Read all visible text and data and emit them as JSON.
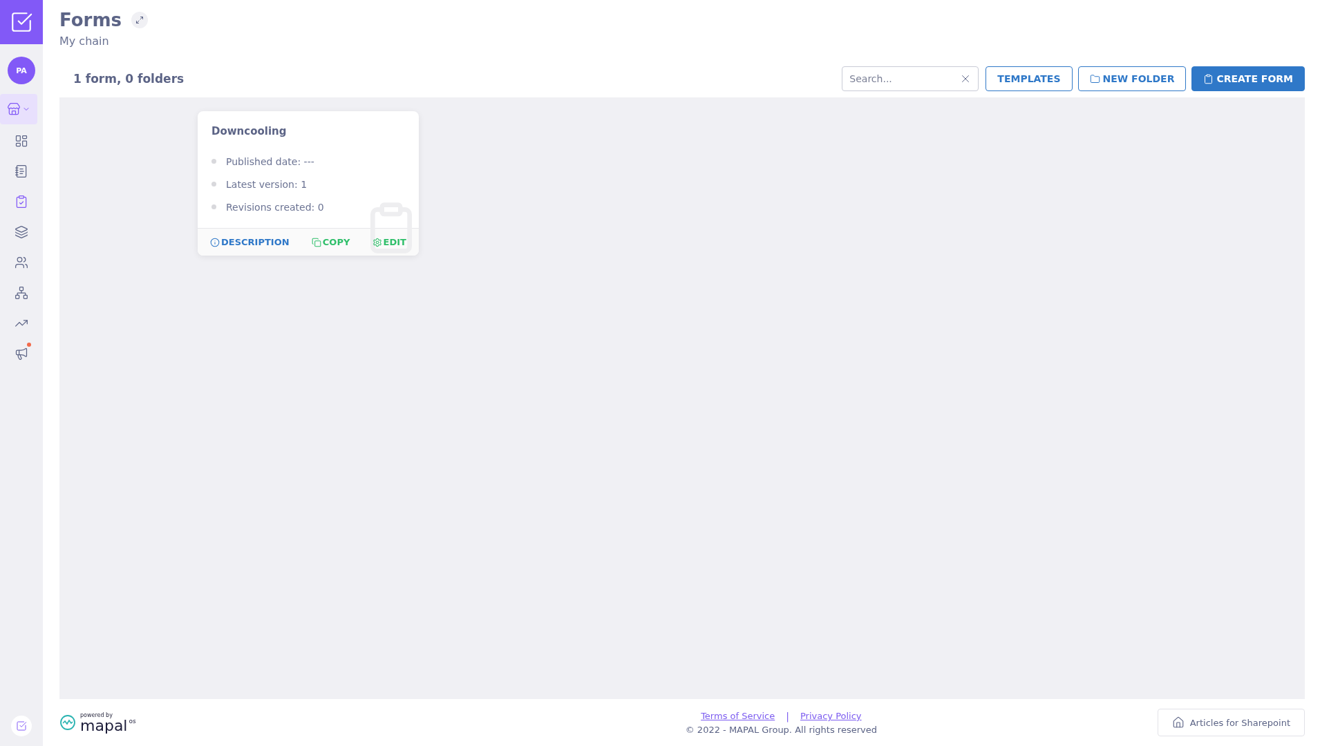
{
  "sidebar": {
    "avatar": "PA",
    "items": [
      {
        "kind": "dropdown",
        "selected": true,
        "badge": false
      },
      {
        "kind": "link",
        "selected": false,
        "badge": false
      },
      {
        "kind": "link",
        "selected": false,
        "badge": false
      },
      {
        "kind": "link",
        "selected": true,
        "badge": false
      },
      {
        "kind": "link",
        "selected": false,
        "badge": false
      },
      {
        "kind": "link",
        "selected": false,
        "badge": false
      },
      {
        "kind": "link",
        "selected": false,
        "badge": false
      },
      {
        "kind": "link",
        "selected": false,
        "badge": false
      },
      {
        "kind": "link",
        "selected": false,
        "badge": true
      }
    ]
  },
  "header": {
    "title": "Forms",
    "subtitle": "My chain"
  },
  "toolbar": {
    "count": "1 form, 0 folders",
    "search": {
      "placeholder": "Search..."
    },
    "buttons": [
      {
        "kind": "outline",
        "label": "TEMPLATES"
      },
      {
        "kind": "outline",
        "label": "NEW FOLDER"
      },
      {
        "kind": "primary",
        "label": "CREATE FORM"
      }
    ]
  },
  "forms": [
    {
      "title": "Downcooling",
      "details": [
        "Published date: ---",
        "Latest version: 1",
        "Revisions created: 0"
      ],
      "actions": [
        {
          "kind": "info",
          "label": "DESCRIPTION"
        },
        {
          "kind": "copy",
          "label": "COPY"
        },
        {
          "kind": "edit",
          "label": "EDIT"
        }
      ]
    }
  ],
  "footer": {
    "brand": {
      "tagline": "powered by",
      "name": "mapal",
      "suffix": "os"
    },
    "links": [
      "Terms of Service",
      "Privacy Policy"
    ],
    "separator": "|",
    "copyright": "© 2022 - MAPAL Group. All rights reserved",
    "help": "Articles for Sharepoint"
  }
}
